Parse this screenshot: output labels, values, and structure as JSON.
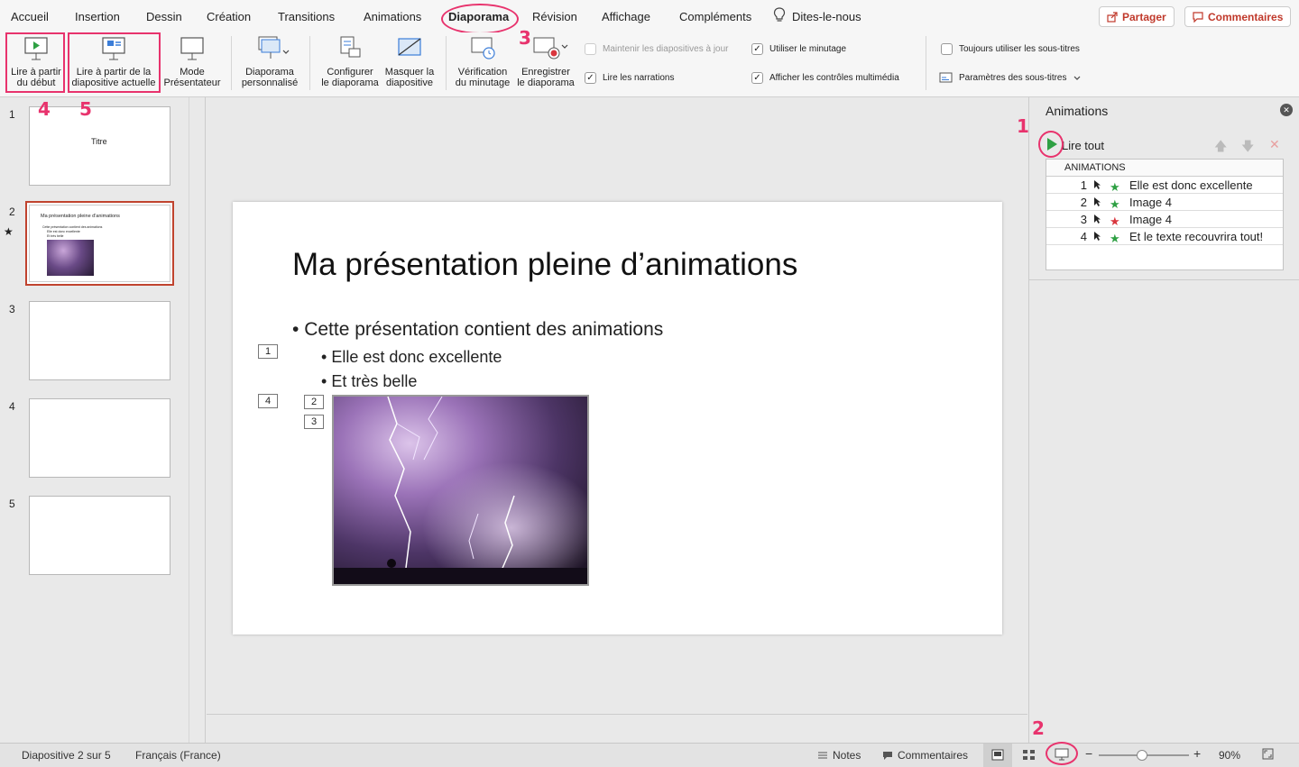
{
  "menu": {
    "tabs": [
      "Accueil",
      "Insertion",
      "Dessin",
      "Création",
      "Transitions",
      "Animations",
      "Diaporama",
      "Révision",
      "Affichage",
      "Compléments"
    ],
    "tell_me": "Dites-le-nous",
    "share": "Partager",
    "comments": "Commentaires"
  },
  "ribbon": {
    "from_start": [
      "Lire à partir",
      "du début"
    ],
    "from_current": [
      "Lire à partir de la",
      "diapositive actuelle"
    ],
    "presenter": [
      "Mode",
      "Présentateur"
    ],
    "custom_show": [
      "Diaporama",
      "personnalisé"
    ],
    "setup_show": [
      "Configurer",
      "le diaporama"
    ],
    "hide_slide": [
      "Masquer la",
      "diapositive"
    ],
    "rehearse": [
      "Vérification",
      "du minutage"
    ],
    "record": [
      "Enregistrer",
      "le diaporama"
    ],
    "keep_updated": "Maintenir les diapositives à jour",
    "play_narrations": "Lire les narrations",
    "use_timings": "Utiliser le minutage",
    "show_media_controls": "Afficher les contrôles multimédia",
    "always_subtitles": "Toujours utiliser les sous-titres",
    "subtitle_settings": "Paramètres des sous-titres"
  },
  "markers": [
    "1",
    "2",
    "3",
    "4",
    "5"
  ],
  "thumbnails": {
    "numbers": [
      "1",
      "2",
      "3",
      "4",
      "5"
    ],
    "slide1_title": "Titre",
    "slide2_title": "Ma présentation pleine d'animations",
    "slide2_b1": "Cette présentation contient des animations",
    "slide2_b2": "Elle est donc excellente",
    "slide2_b3": "Et très belle",
    "anim_star": "★"
  },
  "slide": {
    "title": "Ma présentation pleine d’animations",
    "bullet1": "Cette présentation contient des animations",
    "bullet2": "Elle est donc excellente",
    "bullet3": "Et très belle",
    "tags": [
      "1",
      "4",
      "2",
      "3"
    ]
  },
  "animation_pane": {
    "title": "Animations",
    "play_all": "Lire tout",
    "list_header": "ANIMATIONS",
    "items": [
      {
        "num": "1",
        "label": "Elle est donc excellente",
        "color": "#2ea043"
      },
      {
        "num": "2",
        "label": "Image 4",
        "color": "#2ea043"
      },
      {
        "num": "3",
        "label": "Image 4",
        "color": "#d9363e"
      },
      {
        "num": "4",
        "label": "Et le texte recouvrira tout!",
        "color": "#2ea043"
      }
    ]
  },
  "status": {
    "slide_info": "Diapositive 2 sur 5",
    "language": "Français (France)",
    "notes": "Notes",
    "comments": "Commentaires",
    "zoom": "90%",
    "zoom_level": 0.48
  },
  "colors": {
    "highlight": "#e8336d",
    "accent": "#c0392b",
    "play_green": "#2ea043"
  }
}
